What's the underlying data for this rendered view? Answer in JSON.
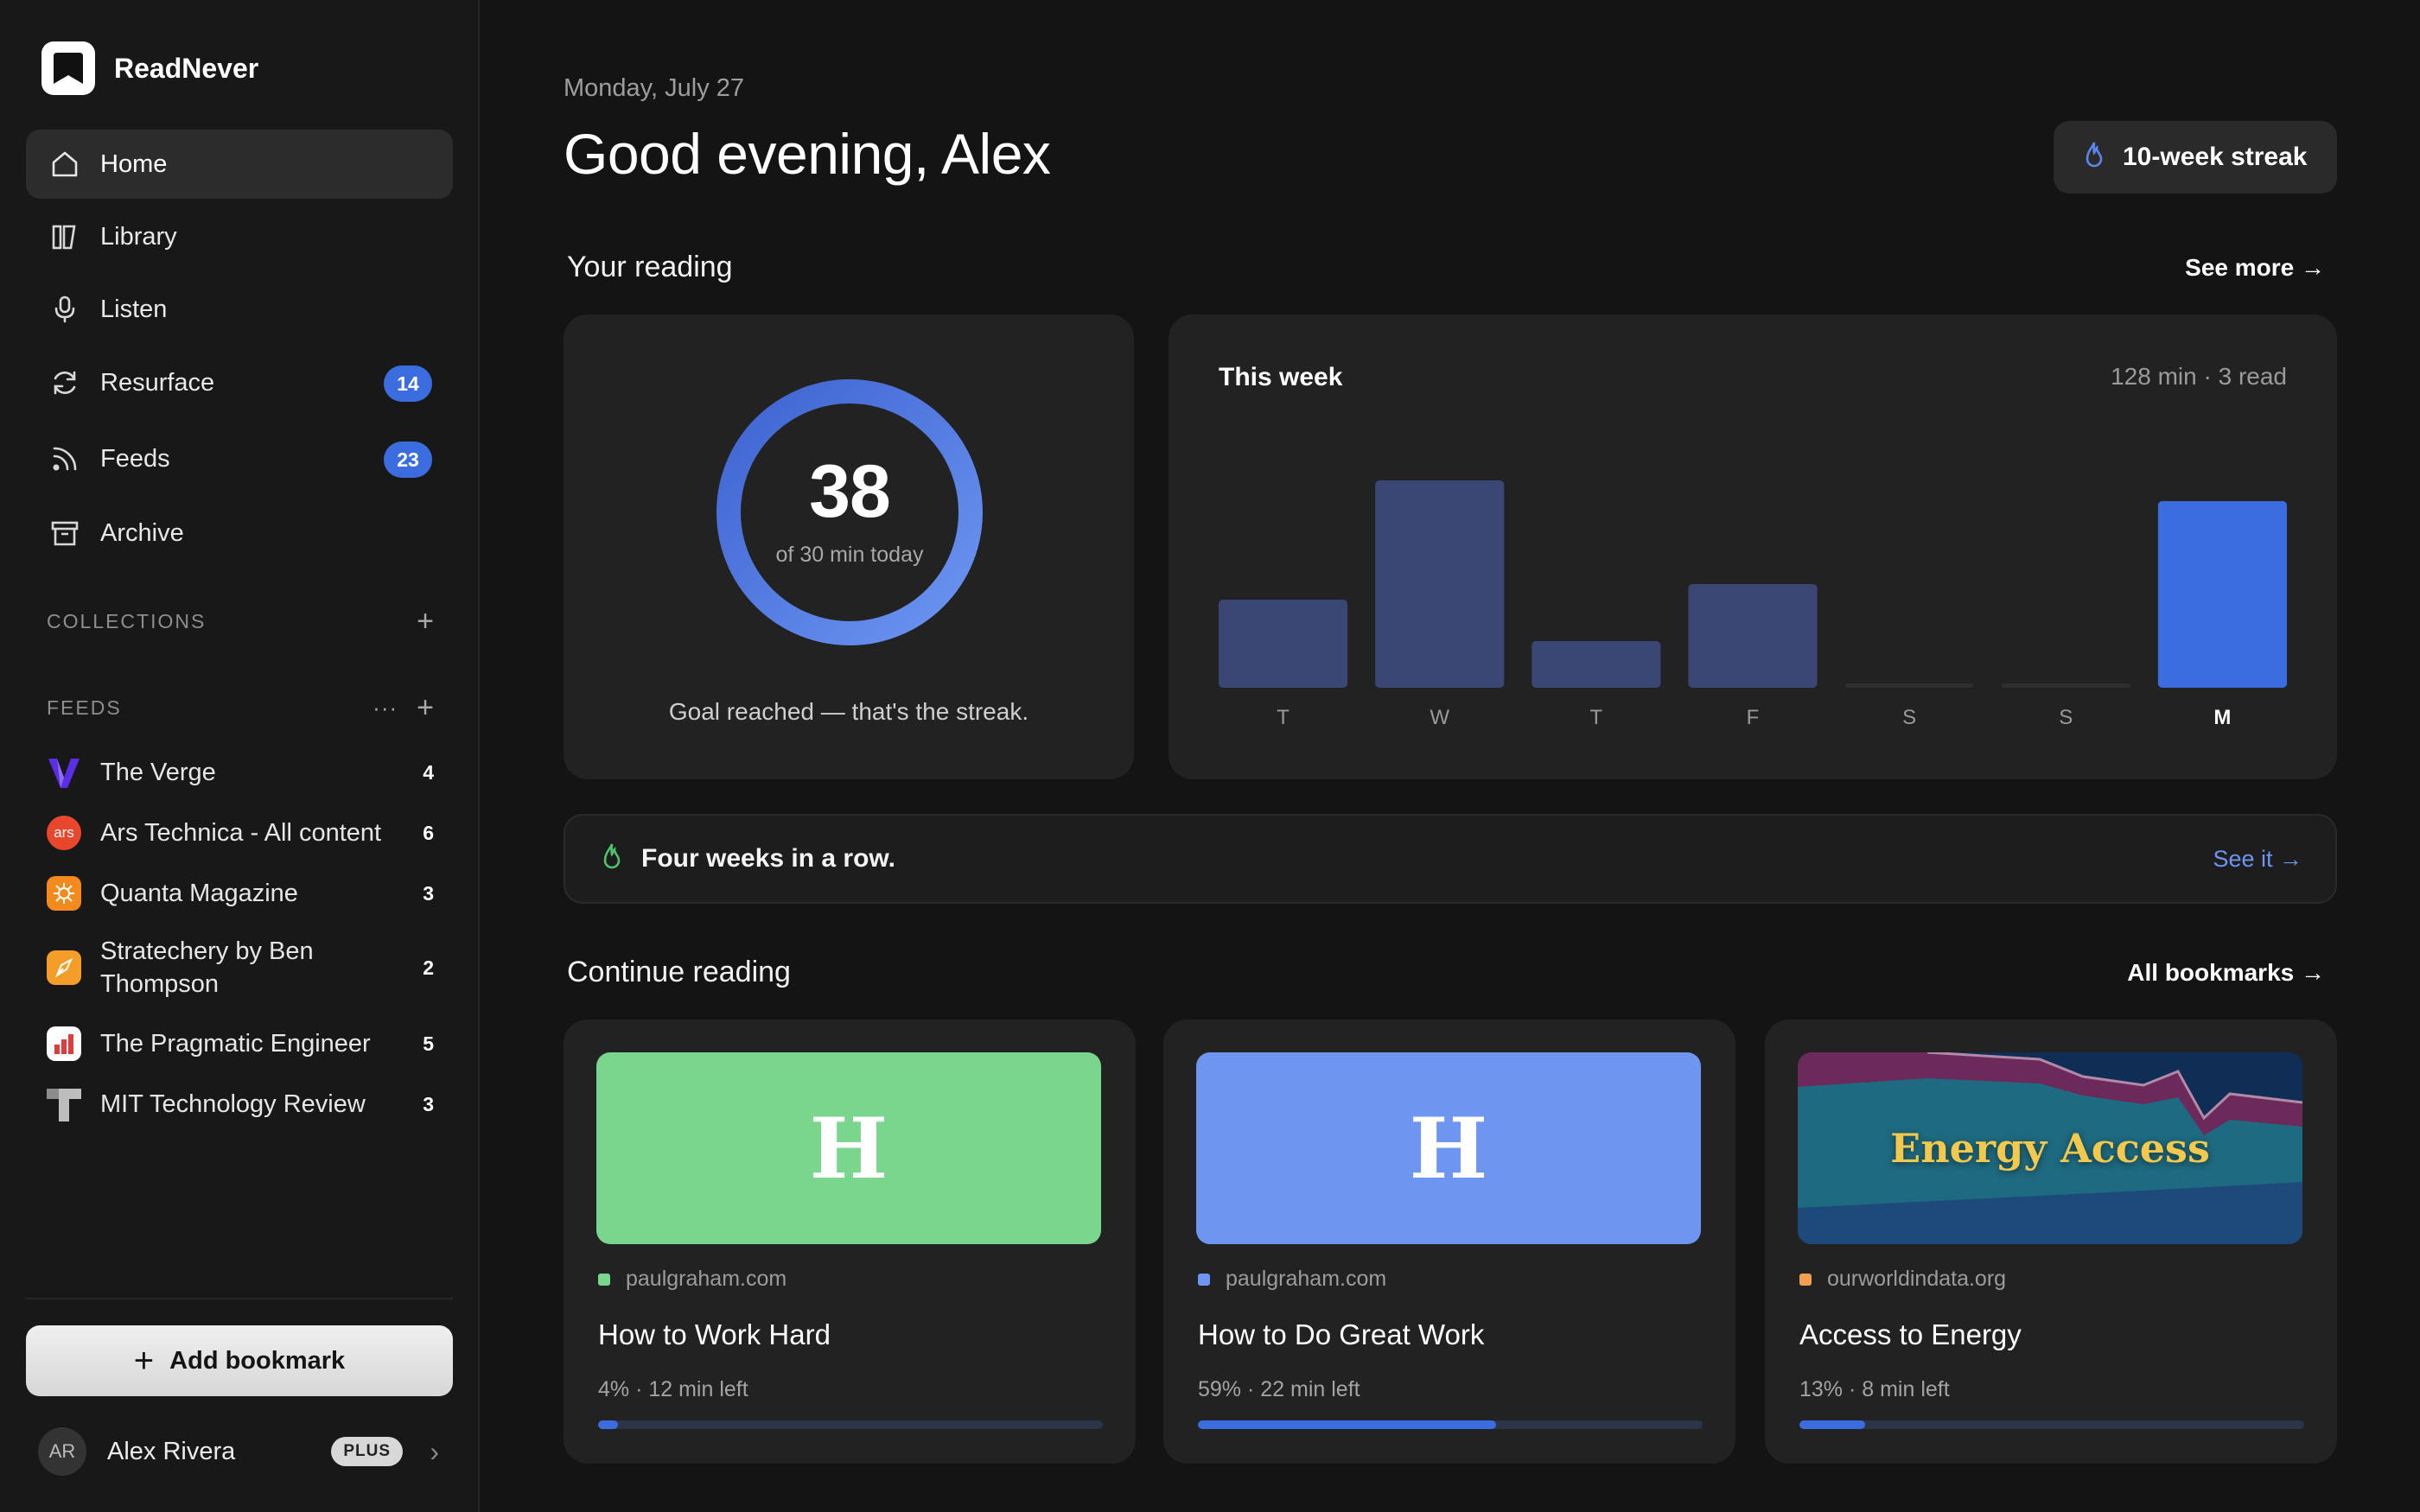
{
  "app": {
    "name": "ReadNever"
  },
  "sidebar": {
    "nav": [
      {
        "label": "Home",
        "icon": "home-icon",
        "active": true,
        "badge": null
      },
      {
        "label": "Library",
        "icon": "library-icon",
        "active": false,
        "badge": null
      },
      {
        "label": "Listen",
        "icon": "microphone-icon",
        "active": false,
        "badge": null
      },
      {
        "label": "Resurface",
        "icon": "refresh-icon",
        "active": false,
        "badge": "14"
      },
      {
        "label": "Feeds",
        "icon": "rss-icon",
        "active": false,
        "badge": "23"
      },
      {
        "label": "Archive",
        "icon": "archive-icon",
        "active": false,
        "badge": null
      }
    ],
    "collections_title": "COLLECTIONS",
    "feeds_title": "FEEDS",
    "feeds": [
      {
        "name": "The Verge",
        "count": "4",
        "icon": "verge-logo-icon",
        "color": "#5a2ee6"
      },
      {
        "name": "Ars Technica - All content",
        "count": "6",
        "icon": "ars-technica-logo-icon",
        "color": "#e8472b",
        "logo_text": "ars"
      },
      {
        "name": "Quanta Magazine",
        "count": "3",
        "icon": "quanta-logo-icon",
        "color": "#f28a1e"
      },
      {
        "name": "Stratechery by Ben Thompson",
        "count": "2",
        "icon": "stratechery-logo-icon",
        "color": "#f59d29"
      },
      {
        "name": "The Pragmatic Engineer",
        "count": "5",
        "icon": "pragmatic-engineer-logo-icon",
        "color": "#e23b3b"
      },
      {
        "name": "MIT Technology Review",
        "count": "3",
        "icon": "mit-tr-logo-icon",
        "color": "#bdbdbd"
      }
    ],
    "add_bookmark_label": "Add bookmark",
    "user": {
      "initials": "AR",
      "name": "Alex Rivera",
      "plan": "PLUS"
    }
  },
  "header": {
    "date": "Monday, July 27",
    "greeting": "Good evening, Alex",
    "streak_label": "10-week streak"
  },
  "reading": {
    "title": "Your reading",
    "see_more": "See more →",
    "goal": {
      "minutes": "38",
      "subtitle": "of 30 min today",
      "progress": 1.0,
      "message": "Goal reached — that's the streak."
    },
    "week": {
      "title": "This week",
      "summary": "128 min · 3 read"
    }
  },
  "chart_data": {
    "type": "bar",
    "categories": [
      "T",
      "W",
      "T",
      "F",
      "S",
      "S",
      "M"
    ],
    "values": [
      17,
      40,
      9,
      20,
      0,
      0,
      36
    ],
    "highlight_index": 6,
    "colors": {
      "default": "#3a4673",
      "highlight": "#3b6de0",
      "empty": "#2f2f2f"
    }
  },
  "banner": {
    "text": "Four weeks in a row.",
    "link": "See it →"
  },
  "continue": {
    "title": "Continue reading",
    "all_link": "All bookmarks →",
    "items": [
      {
        "thumb_text": "H",
        "thumb_color": "#7bd68d",
        "source": "paulgraham.com",
        "source_color": "#7bd68d",
        "title": "How to Work Hard",
        "progress_text": "4% · 12 min left",
        "progress": 0.04
      },
      {
        "thumb_text": "H",
        "thumb_color": "#6e95ef",
        "source": "paulgraham.com",
        "source_color": "#6e95ef",
        "title": "How to Do Great Work",
        "progress_text": "59% · 22 min left",
        "progress": 0.59
      },
      {
        "thumb_text": "Energy Access",
        "thumb_color": "#1b5a78",
        "source": "ourworldindata.org",
        "source_color": "#f0a050",
        "title": "Access to Energy",
        "progress_text": "13% · 8 min left",
        "progress": 0.13
      }
    ]
  }
}
